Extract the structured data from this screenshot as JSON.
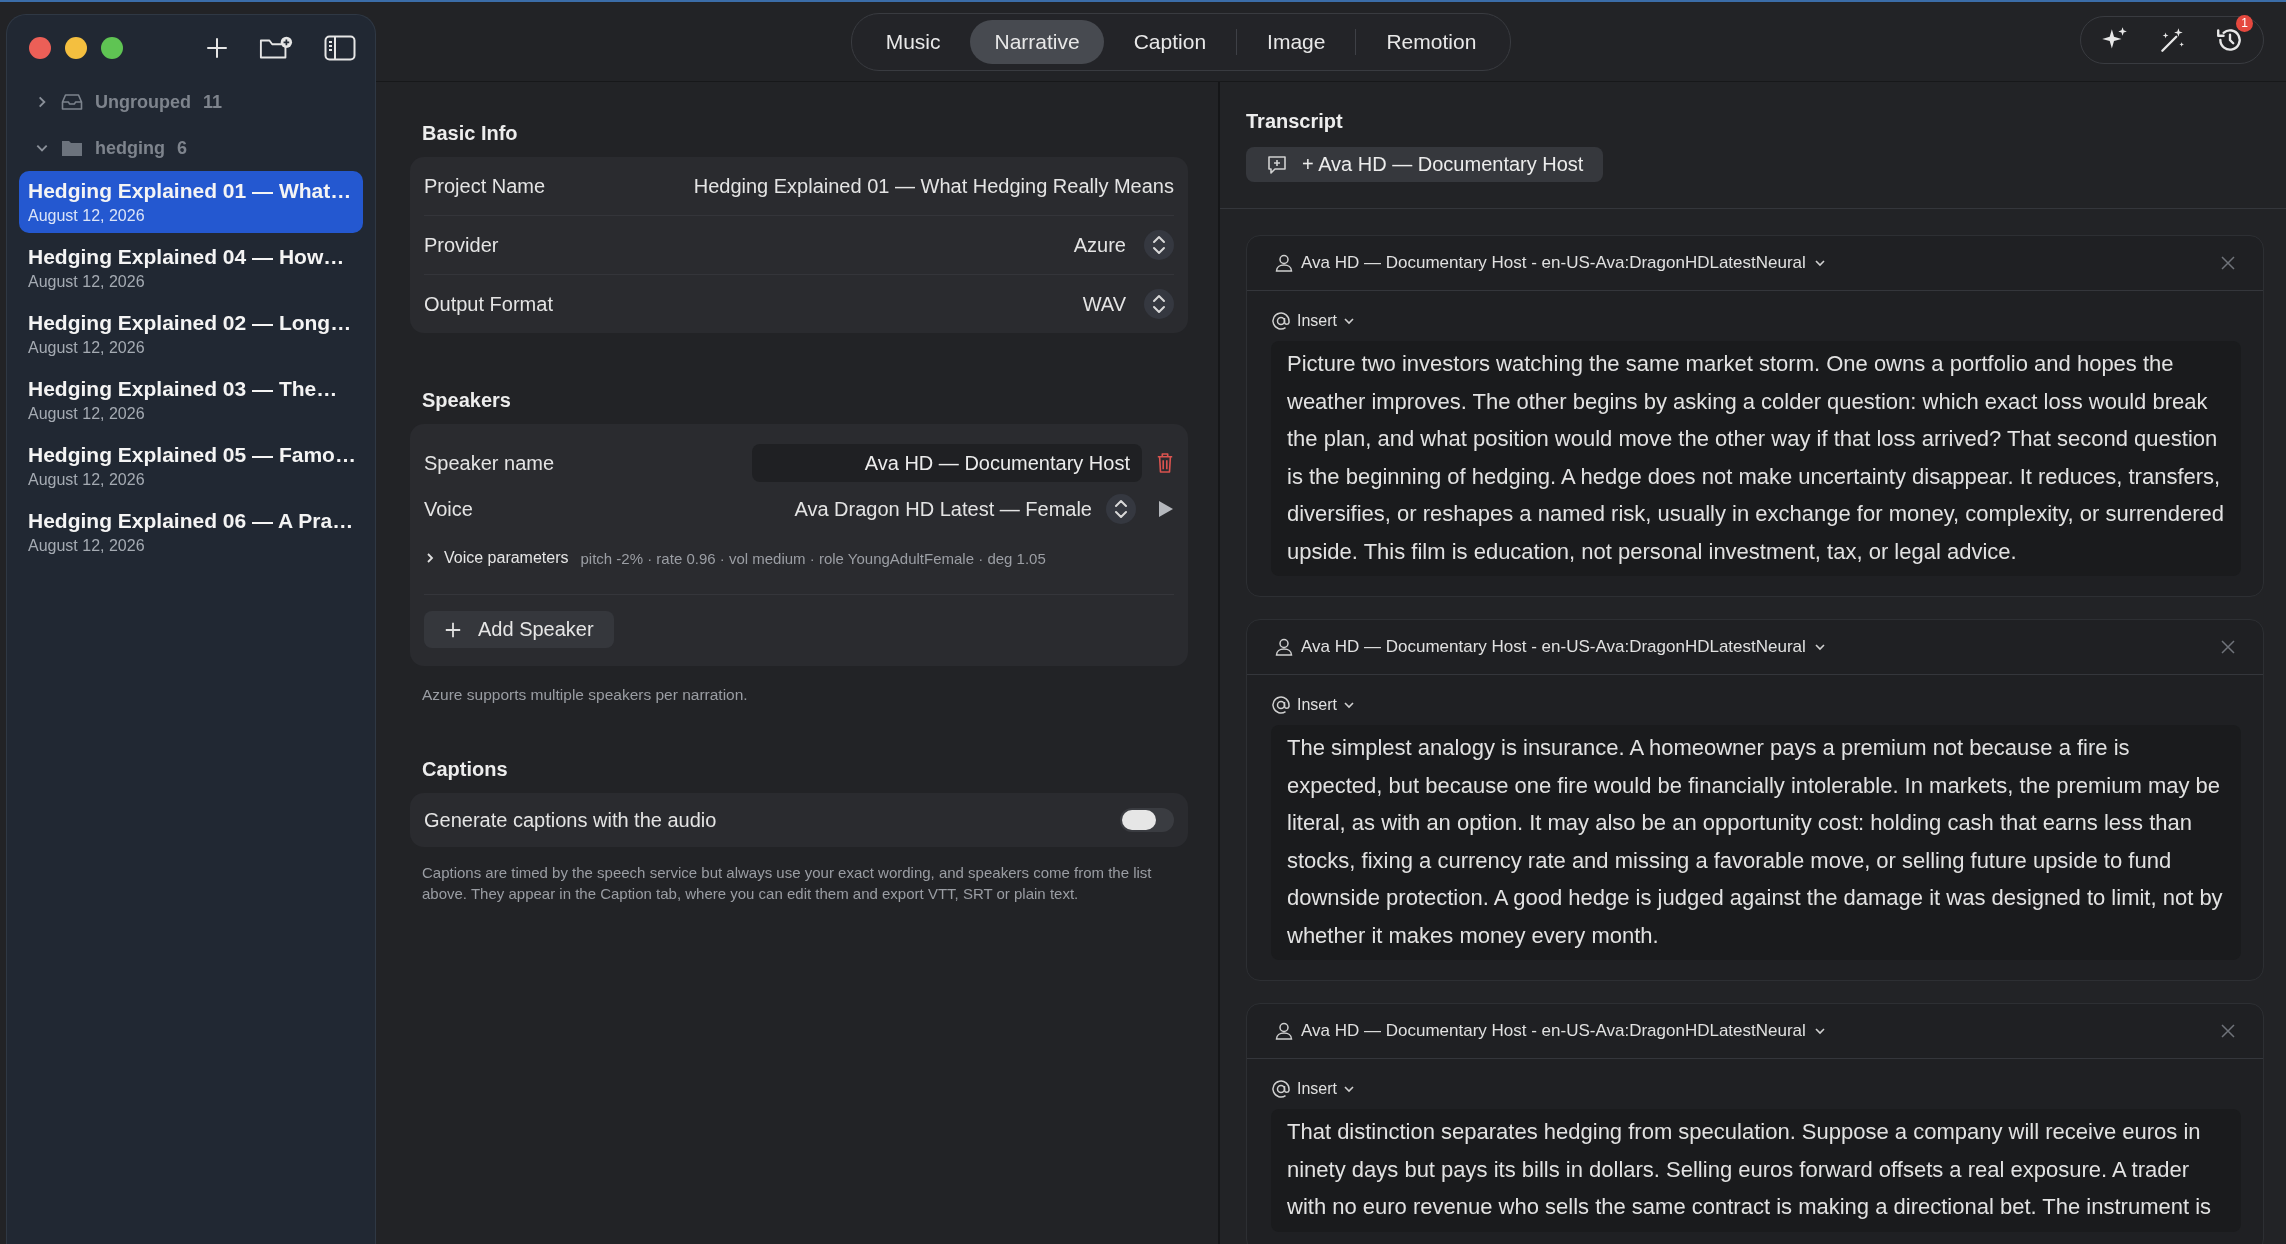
{
  "sidebar": {
    "groups": [
      {
        "name": "Ungrouped",
        "count": "11",
        "expanded": false,
        "kind": "inbox"
      },
      {
        "name": "hedging",
        "count": "6",
        "expanded": true,
        "kind": "folder",
        "items": [
          {
            "title": "Hedging Explained 01 — What…",
            "date": "August 12, 2026",
            "selected": true
          },
          {
            "title": "Hedging Explained 04 — How…",
            "date": "August 12, 2026",
            "selected": false
          },
          {
            "title": "Hedging Explained 02 — Long…",
            "date": "August 12, 2026",
            "selected": false
          },
          {
            "title": "Hedging Explained 03 — The…",
            "date": "August 12, 2026",
            "selected": false
          },
          {
            "title": "Hedging Explained 05 — Famo…",
            "date": "August 12, 2026",
            "selected": false
          },
          {
            "title": "Hedging Explained 06 — A Pra…",
            "date": "August 12, 2026",
            "selected": false
          }
        ]
      }
    ]
  },
  "tabs": [
    {
      "label": "Music",
      "selected": false
    },
    {
      "label": "Narrative",
      "selected": true
    },
    {
      "label": "Caption",
      "selected": false
    },
    {
      "label": "Image",
      "selected": false
    },
    {
      "label": "Remotion",
      "selected": false
    }
  ],
  "toolbar": {
    "history_badge": "1"
  },
  "basic_info": {
    "heading": "Basic Info",
    "fields": [
      {
        "label": "Project Name",
        "value": "Hedging Explained 01 — What Hedging Really Means",
        "kind": "text"
      },
      {
        "label": "Provider",
        "value": "Azure",
        "kind": "select"
      },
      {
        "label": "Output Format",
        "value": "WAV",
        "kind": "select"
      }
    ]
  },
  "speakers": {
    "heading": "Speakers",
    "speaker_name_label": "Speaker name",
    "speaker_name": "Ava HD — Documentary Host",
    "voice_label": "Voice",
    "voice": "Ava Dragon HD Latest — Female",
    "parameters_label": "Voice parameters",
    "parameters": "pitch -2% · rate 0.96 · vol medium · role YoungAdultFemale · deg 1.05",
    "add_button": "Add Speaker",
    "note": "Azure supports multiple speakers per narration."
  },
  "captions": {
    "heading": "Captions",
    "toggle_label": "Generate captions with the audio",
    "on": false,
    "note": "Captions are timed by the speech service but always use your exact wording, and speakers come from the list above. They appear in the Caption tab, where you can edit them and export VTT, SRT or plain text."
  },
  "transcript": {
    "heading": "Transcript",
    "add_button": "+ Ava HD — Documentary Host",
    "segments": [
      {
        "speaker": "Ava HD — Documentary Host - en-US-Ava:DragonHDLatestNeural",
        "insert": "Insert",
        "text": "Picture two investors watching the same market storm. One owns a portfolio and hopes the weather improves. The other begins by asking a colder question: which exact loss would break the plan, and what position would move the other way if that loss arrived? That second question is the beginning of hedging. A hedge does not make uncertainty disappear. It reduces, transfers, diversifies, or reshapes a named risk, usually in exchange for money, complexity, or surrendered upside. This film is education, not personal investment, tax, or legal advice."
      },
      {
        "speaker": "Ava HD — Documentary Host - en-US-Ava:DragonHDLatestNeural",
        "insert": "Insert",
        "text": "The simplest analogy is insurance. A homeowner pays a premium not because a fire is expected, but because one fire would be financially intolerable. In markets, the premium may be literal, as with an option. It may also be an opportunity cost: holding cash that earns less than stocks, fixing a currency rate and missing a favorable move, or selling future upside to fund downside protection. A good hedge is judged against the damage it was designed to limit, not by whether it makes money every month."
      },
      {
        "speaker": "Ava HD — Documentary Host - en-US-Ava:DragonHDLatestNeural",
        "insert": "Insert",
        "text": "That distinction separates hedging from speculation. Suppose a company will receive euros in ninety days but pays its bills in dollars. Selling euros forward offsets a real exposure. A trader with no euro revenue who sells the same contract is making a directional bet. The instrument is"
      }
    ]
  }
}
